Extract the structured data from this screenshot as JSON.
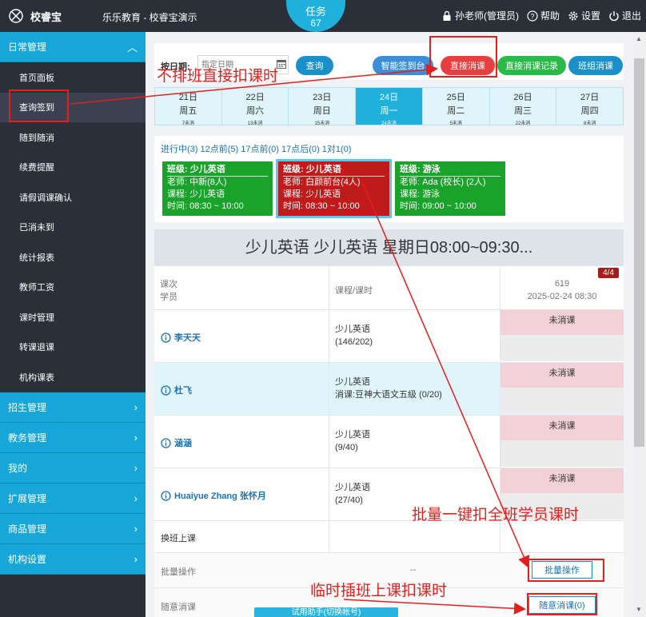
{
  "topbar": {
    "logo_text": "校睿宝",
    "app_title": "乐乐教育 - 校睿宝演示",
    "task_label": "任务",
    "task_count": "67",
    "user": "孙老师(管理员)",
    "help": "帮助",
    "settings": "设置",
    "logout": "退出"
  },
  "sidebar": {
    "sections": [
      {
        "label": "日常管理",
        "expanded": true
      },
      {
        "label": "招生管理"
      },
      {
        "label": "教务管理"
      },
      {
        "label": "我的"
      },
      {
        "label": "扩展管理"
      },
      {
        "label": "商品管理"
      },
      {
        "label": "机构设置"
      }
    ],
    "items": [
      "首页面板",
      "查询签到",
      "随到随消",
      "续费提醒",
      "请假调课确认",
      "已消未到",
      "统计报表",
      "教师工资",
      "课时管理",
      "转课退课",
      "机构课表"
    ]
  },
  "query": {
    "label": "按日期:",
    "date_placeholder": "指定日期",
    "query_btn": "查询",
    "smart_btn": "智能签到台",
    "direct_btn": "直接消课",
    "record_btn": "直接消课记录",
    "class_btn": "班组消课"
  },
  "days": [
    {
      "date": "21日",
      "weekday": "周五",
      "count": "7未消"
    },
    {
      "date": "22日",
      "weekday": "周六",
      "count": "13未消"
    },
    {
      "date": "23日",
      "weekday": "周日",
      "count": "15未消"
    },
    {
      "date": "24日",
      "weekday": "周一",
      "count": "24未消",
      "active": true
    },
    {
      "date": "25日",
      "weekday": "周二",
      "count": "5未消"
    },
    {
      "date": "26日",
      "weekday": "周三",
      "count": "22未消"
    },
    {
      "date": "27日",
      "weekday": "周四",
      "count": "8未消"
    }
  ],
  "status_line": "进行中(3) 12点前(5) 17点前(0) 17点后(0) 1对1(0)",
  "cards": [
    {
      "title": "班级: 少儿英语",
      "teacher": "老师: 中新(8人)",
      "course": "课程: 少儿英语",
      "time": "时间: 08:30 ~ 10:00"
    },
    {
      "title": "班级: 少儿英语",
      "teacher": "老师: 白颜前台(4人)",
      "course": "课程: 少儿英语",
      "time": "时间: 08:30 ~ 10:00"
    },
    {
      "title": "班级: 游泳",
      "teacher": "老师: Ada (校长) (2人)",
      "course": "课程: 游泳",
      "time": "时间: 09:00 ~ 10:00"
    }
  ],
  "panel": {
    "title": "少儿英语 少儿英语 星期日08:00~09:30...",
    "header": {
      "col1_line1": "课次",
      "col1_line2": "学员",
      "col2": "课程/课时",
      "col3_line1": "619",
      "col3_line2": "2025-02-24 08:30",
      "badge": "4/4"
    },
    "students": [
      {
        "name": "李天天",
        "course": "少儿英语",
        "detail": "(146/202)",
        "status": "未消课"
      },
      {
        "name": "杜飞",
        "course": "少儿英语",
        "detail": "消课:豆神大语文五级 (0/20)",
        "status": "未消课",
        "highlight": true
      },
      {
        "name": "涵涵",
        "course": "少儿英语",
        "detail": "(9/40)",
        "status": "未消课"
      },
      {
        "name": "Huaiyue Zhang 张怀月",
        "course": "少儿英语",
        "detail": "(27/40)",
        "status": "未消课"
      }
    ],
    "transfer_label": "换班上课",
    "batch_label": "批量操作",
    "batch_dash": "--",
    "batch_btn": "批量操作",
    "random_label": "随意消课",
    "random_btn": "随意消课(0)"
  },
  "trial_btn": "试用助手(切换帐号)",
  "annotations": {
    "a1": "不排班直接扣课时",
    "a2": "批量一键扣全班学员课时",
    "a3": "临时插班上课扣课时"
  },
  "colors": {
    "accent": "#16a6d8",
    "danger": "#e5403f",
    "success": "#2aba4a",
    "annotation": "#e3201b"
  }
}
